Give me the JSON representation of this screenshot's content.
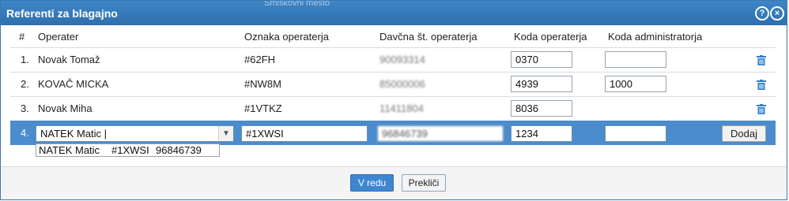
{
  "window": {
    "title": "Referenti za blagajno",
    "background_text": "Smiskovni mesto",
    "help_symbol": "?",
    "close_symbol": "×"
  },
  "table": {
    "headers": [
      "#",
      "Operater",
      "Oznaka operaterja",
      "Davčna št. operaterja",
      "Koda operaterja",
      "Koda administratorja"
    ],
    "rows": [
      {
        "num": "1.",
        "operater": "Novak Tomaž",
        "oznaka": "#62FH",
        "davcna": "90093314",
        "koda": "0370",
        "koda_admin": ""
      },
      {
        "num": "2.",
        "operater": "KOVAČ MICKA",
        "oznaka": "#NW8M",
        "davcna": "85000006",
        "koda": "4939",
        "koda_admin": "1000"
      },
      {
        "num": "3.",
        "operater": "Novak Miha",
        "oznaka": "#1VTKZ",
        "davcna": "11411804",
        "koda": "8036",
        "koda_admin": ""
      }
    ],
    "edit_row": {
      "num": "4.",
      "operater": "NATEK Matic |",
      "oznaka": "#1XWSI",
      "davcna": "96846739",
      "koda": "1234",
      "koda_admin": "",
      "add_label": "Dodaj"
    },
    "suggestion": {
      "name": "NATEK Matic",
      "oznaka": "#1XWSI",
      "davcna": "96846739"
    }
  },
  "footer": {
    "ok_label": "V redu",
    "cancel_label": "Prekliči"
  },
  "colors": {
    "titlebar": "#3a7bbf",
    "selected_row": "#4a8ccc",
    "trash": "#2f7fd0",
    "ok_button": "#3f86d0"
  },
  "icons": {
    "help": "help-icon",
    "close": "close-icon",
    "delete": "trash-icon",
    "dropdown": "chevron-down-icon"
  }
}
